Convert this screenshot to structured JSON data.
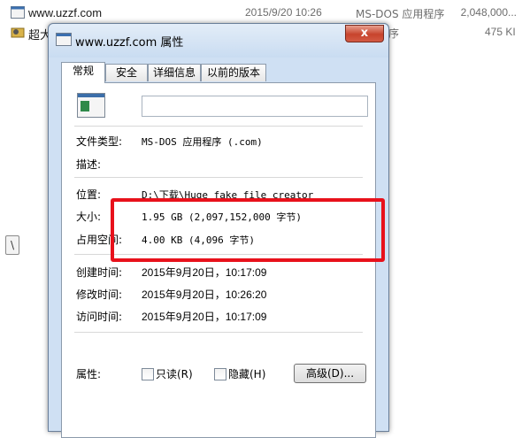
{
  "explorer": {
    "rows": [
      {
        "name": "www.uzzf.com",
        "date": "2015/9/20 10:26",
        "type": "MS-DOS 应用程序",
        "size": "2,048,000..."
      },
      {
        "name": "超大",
        "type_partial": "序",
        "size": "475 KI"
      }
    ],
    "left_marker": "\\"
  },
  "window": {
    "title": "www.uzzf.com 属性",
    "close_glyph": "x",
    "tabs": [
      {
        "label": "常规"
      },
      {
        "label": "安全"
      },
      {
        "label": "详细信息"
      },
      {
        "label": "以前的版本"
      }
    ],
    "filename_value": "",
    "fields": {
      "file_type": {
        "label": "文件类型:",
        "value": "MS-DOS 应用程序 (.com)"
      },
      "description": {
        "label": "描述:",
        "value": ""
      },
      "location": {
        "label": "位置:",
        "value": "D:\\下载\\Huge fake file creator"
      },
      "size": {
        "label": "大小:",
        "value": "1.95 GB (2,097,152,000 字节)"
      },
      "size_on_disk": {
        "label": "占用空间:",
        "value": "4.00 KB (4,096 字节)"
      },
      "created": {
        "label": "创建时间:",
        "value": "2015年9月20日，10:17:09"
      },
      "modified": {
        "label": "修改时间:",
        "value": "2015年9月20日，10:26:20"
      },
      "accessed": {
        "label": "访问时间:",
        "value": "2015年9月20日，10:17:09"
      }
    },
    "attributes": {
      "label": "属性:",
      "readonly": "只读(R)",
      "hidden": "隐藏(H)",
      "advanced_button": "高级(D)..."
    }
  },
  "colors": {
    "highlight": "#e8111b",
    "window_frame": "#cfe0f3"
  }
}
